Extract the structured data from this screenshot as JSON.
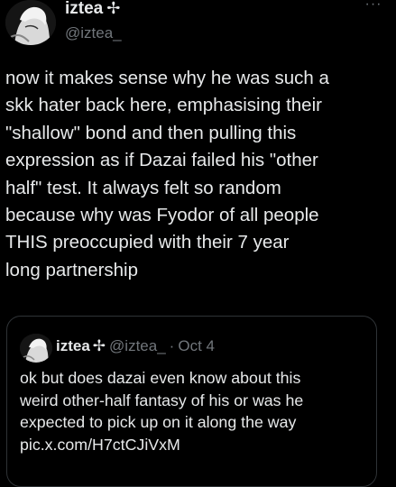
{
  "author": {
    "display_name": "iztea",
    "name_symbol": "✢",
    "handle": "@iztea_",
    "more_label": "···"
  },
  "tweet": {
    "lines": [
      "now it makes sense why he was such a",
      "skk hater back here, emphasising their",
      "\"shallow\" bond and then pulling this",
      "expression as if Dazai failed his \"other",
      "half\" test. It always felt so random",
      "because why was Fyodor of all people",
      "THIS preoccupied with their 7 year",
      "long partnership"
    ]
  },
  "quote": {
    "display_name": "iztea",
    "name_symbol": "✢",
    "handle": "@iztea_",
    "separator": "·",
    "date": "Oct 4",
    "lines": [
      "ok but does dazai even know about this",
      "weird other-half fantasy of his or was he",
      "expected to pick up on it along the way",
      "pic.x.com/H7ctCJiVxM"
    ]
  },
  "colors": {
    "background": "#000000",
    "text_primary": "#e7e9ea",
    "text_secondary": "#71767b",
    "border": "#2f3336"
  },
  "icons": {
    "avatar": "avatar-image",
    "more": "more-options-icon"
  }
}
